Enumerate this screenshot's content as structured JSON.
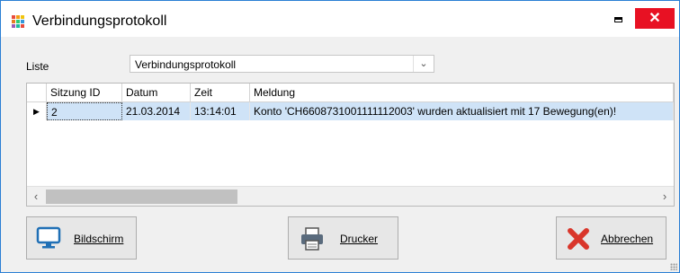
{
  "window": {
    "title": "Verbindungsprotokoll",
    "close_glyph": "✕"
  },
  "form": {
    "liste_label": "Liste",
    "liste_value": "Verbindungsprotokoll"
  },
  "grid": {
    "columns": [
      "Sitzung ID",
      "Datum",
      "Zeit",
      "Meldung"
    ],
    "rows": [
      {
        "sitzung_id": "2",
        "datum": "21.03.2014",
        "zeit": "13:14:01",
        "meldung": "Konto 'CH6608731001111112003' wurden aktualisiert mit 17 Bewegung(en)!"
      }
    ],
    "selected_row_marker": "▶"
  },
  "buttons": {
    "bildschirm": "Bildschirm",
    "drucker": "Drucker",
    "abbrechen": "Abbrechen"
  },
  "colors": {
    "selection": "#cfe3f7",
    "close_red": "#e81123",
    "window_border": "#2b7fd4"
  }
}
